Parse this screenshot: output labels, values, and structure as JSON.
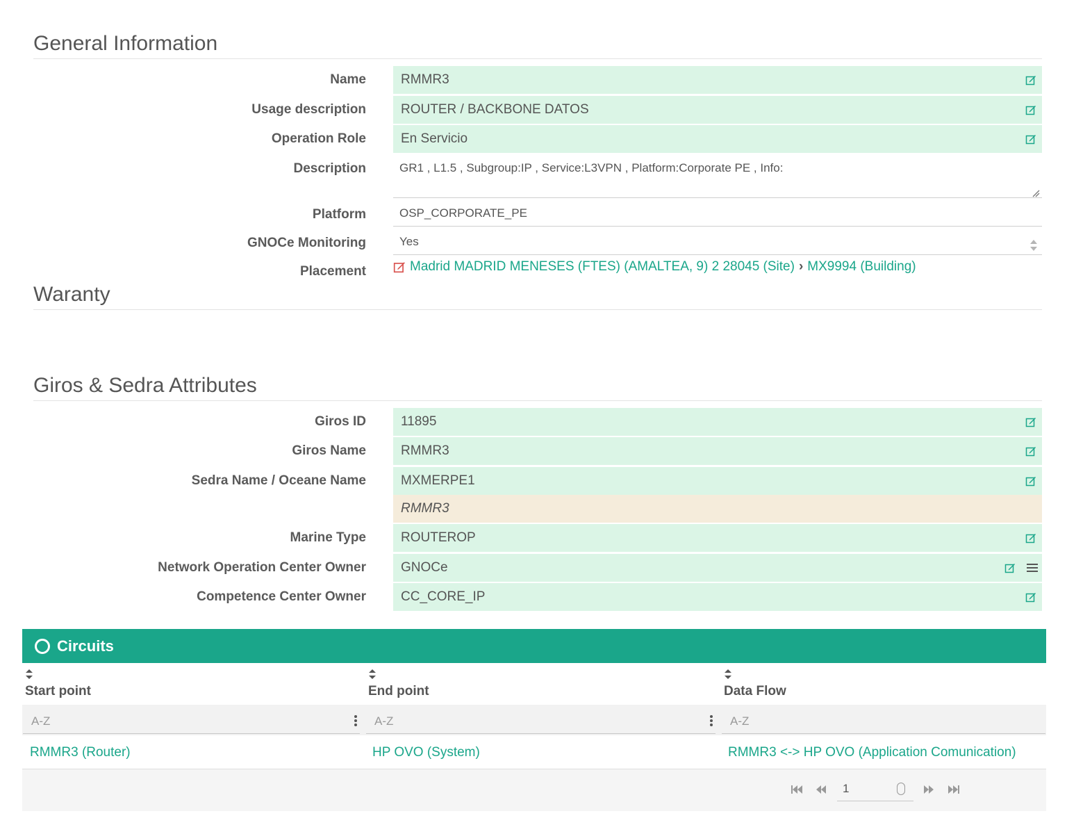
{
  "general": {
    "title": "General Information",
    "name_label": "Name",
    "name_value": "RMMR3",
    "usage_label": "Usage description",
    "usage_value": "ROUTER / BACKBONE DATOS",
    "role_label": "Operation Role",
    "role_value": "En Servicio",
    "description_label": "Description",
    "description_value": "GR1 , L1.5 , Subgroup:IP , Service:L3VPN , Platform:Corporate PE , Info:",
    "platform_label": "Platform",
    "platform_value": "OSP_CORPORATE_PE",
    "monitoring_label": "GNOCe Monitoring",
    "monitoring_value": "Yes",
    "placement_label": "Placement",
    "placement_site": "Madrid MADRID MENESES (FTES) (AMALTEA, 9) 2 28045 (Site)",
    "placement_building": "MX9994 (Building)"
  },
  "warranty": {
    "title": "Waranty"
  },
  "giros": {
    "title": "Giros & Sedra Attributes",
    "giros_id_label": "Giros ID",
    "giros_id_value": "11895",
    "giros_name_label": "Giros Name",
    "giros_name_value": "RMMR3",
    "sedra_label": "Sedra Name / Oceane Name",
    "sedra_value": "MXMERPE1",
    "oceane_value": "RMMR3",
    "marine_label": "Marine Type",
    "marine_value": "ROUTEROP",
    "noc_label": "Network Operation Center Owner",
    "noc_value": "GNOCe",
    "cc_label": "Competence Center Owner",
    "cc_value": "CC_CORE_IP"
  },
  "circuits": {
    "title": "Circuits",
    "columns": [
      "Start point",
      "End point",
      "Data Flow"
    ],
    "filter_placeholder": "A-Z",
    "rows": [
      [
        "RMMR3 (Router)",
        "HP OVO (System)",
        "RMMR3 <-> HP OVO (Application Comunication)"
      ]
    ],
    "page": "1"
  },
  "colors": {
    "accent": "#1aa68a",
    "field_bg": "#dbf5e6",
    "warn_bg": "#f5ecdb"
  }
}
